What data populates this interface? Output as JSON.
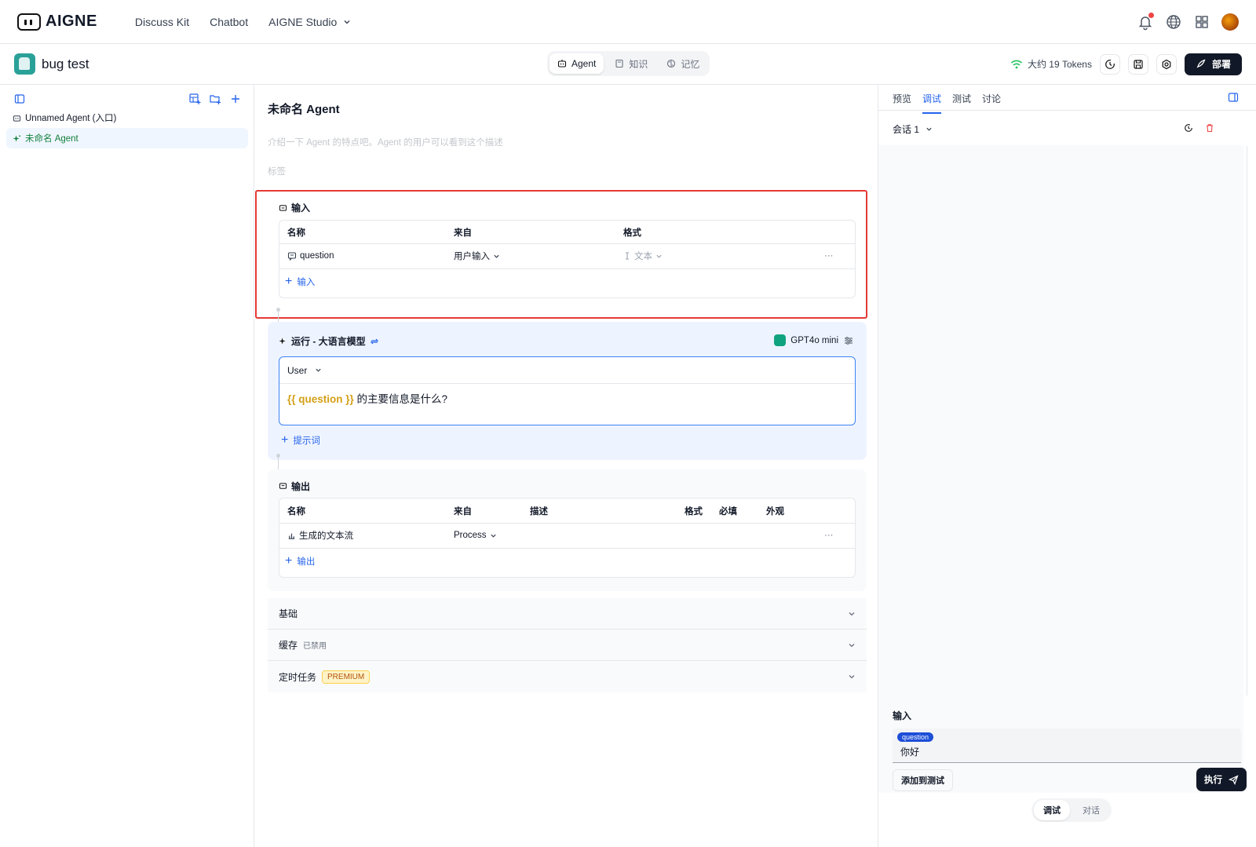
{
  "topnav": {
    "brand": "AIGNE",
    "links": [
      "Discuss Kit",
      "Chatbot",
      "AIGNE Studio"
    ]
  },
  "project": {
    "name": "bug test",
    "tabs": [
      {
        "label": "Agent",
        "icon": "robot-icon",
        "active": true
      },
      {
        "label": "知识",
        "icon": "book-icon",
        "active": false
      },
      {
        "label": "记忆",
        "icon": "brain-icon",
        "active": false
      }
    ],
    "tokens": "大约 19 Tokens",
    "deploy_label": "部署"
  },
  "sidebar": {
    "items": [
      {
        "label": "Unnamed Agent (入口)",
        "selected": false
      },
      {
        "label": "未命名 Agent",
        "selected": true
      }
    ]
  },
  "editor": {
    "title": "未命名 Agent",
    "description_placeholder": "介绍一下 Agent 的特点吧。Agent 的用户可以看到这个描述",
    "tags_placeholder": "标签",
    "input": {
      "heading": "输入",
      "headers": [
        "名称",
        "来自",
        "格式"
      ],
      "row": {
        "name": "question",
        "source": "用户输入",
        "format": "文本",
        "more": "···"
      },
      "add_label": "输入"
    },
    "run": {
      "heading": "运行 - 大语言模型",
      "model": "GPT4o mini",
      "role": "User",
      "prompt_var": "{{ question }}",
      "prompt_text": " 的主要信息是什么?",
      "add_label": "提示词"
    },
    "output": {
      "heading": "输出",
      "headers": [
        "名称",
        "来自",
        "描述",
        "格式",
        "必填",
        "外观"
      ],
      "row": {
        "name": "生成的文本流",
        "source": "Process",
        "more": "···"
      },
      "add_label": "输出"
    },
    "accordions": [
      {
        "label": "基础",
        "note": ""
      },
      {
        "label": "缓存",
        "note": "已禁用"
      },
      {
        "label": "定时任务",
        "badge": "PREMIUM"
      }
    ]
  },
  "right": {
    "tabs": [
      {
        "label": "预览",
        "active": false
      },
      {
        "label": "调试",
        "active": true
      },
      {
        "label": "测试",
        "active": false
      },
      {
        "label": "讨论",
        "active": false
      }
    ],
    "session": "会话 1",
    "input_label": "输入",
    "field_badge": "question",
    "field_value": "你好",
    "add_test": "添加到测试",
    "execute": "执行",
    "modes": [
      "调试",
      "对话"
    ]
  }
}
